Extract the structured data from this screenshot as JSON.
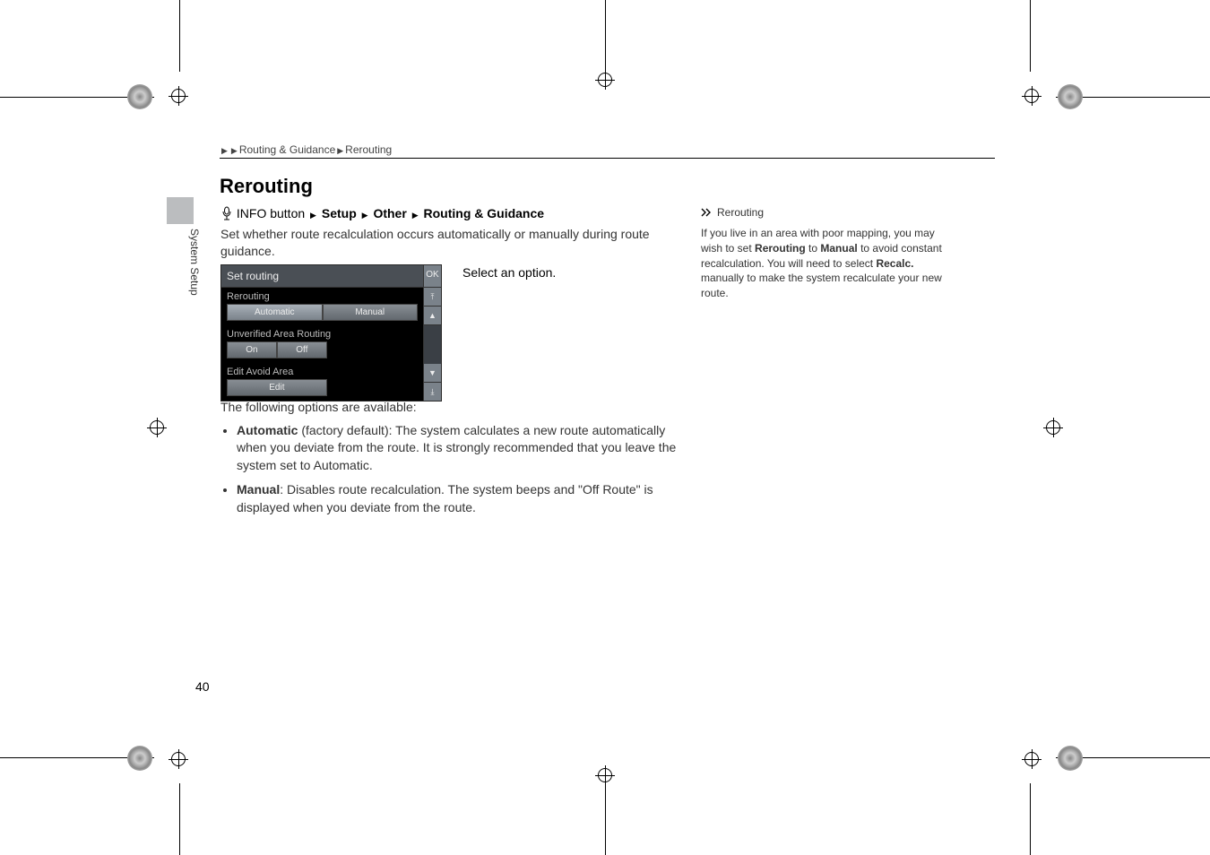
{
  "header": {
    "breadcrumb_a": "Routing & Guidance",
    "breadcrumb_b": "Rerouting"
  },
  "section_title": "Rerouting",
  "sidebar_tab_label": "System Setup",
  "nav_path": {
    "btn": "INFO button",
    "s1": "Setup",
    "s2": "Other",
    "s3": "Routing & Guidance"
  },
  "intro": "Set whether route recalculation occurs automatically or manually during route guidance.",
  "select_text": "Select an option.",
  "screenshot": {
    "title": "Set routing",
    "ok": "OK",
    "group1": {
      "label": "Rerouting",
      "opt_a": "Automatic",
      "opt_b": "Manual"
    },
    "group2": {
      "label": "Unverified Area Routing",
      "opt_a": "On",
      "opt_b": "Off"
    },
    "group3": {
      "label": "Edit Avoid Area",
      "opt_a": "Edit"
    }
  },
  "below": {
    "lead": "The following options are available:",
    "opt1_label": "Automatic",
    "opt1_suffix": " (factory default): The system calculates a new route automatically when you deviate from the route. It is strongly recommended that you leave the system set to Automatic.",
    "opt2_label": "Manual",
    "opt2_suffix": ": Disables route recalculation. The system beeps and \"Off Route\" is displayed when you deviate from the route."
  },
  "note": {
    "title": "Rerouting",
    "text_a": "If you live in an area with poor mapping, you may wish to set ",
    "text_b": "Rerouting",
    "text_c": " to ",
    "text_d": "Manual",
    "text_e": " to avoid constant recalculation. You will need to select ",
    "text_f": "Recalc.",
    "text_g": " manually to make the system recalculate your new route."
  },
  "page_number": "40"
}
